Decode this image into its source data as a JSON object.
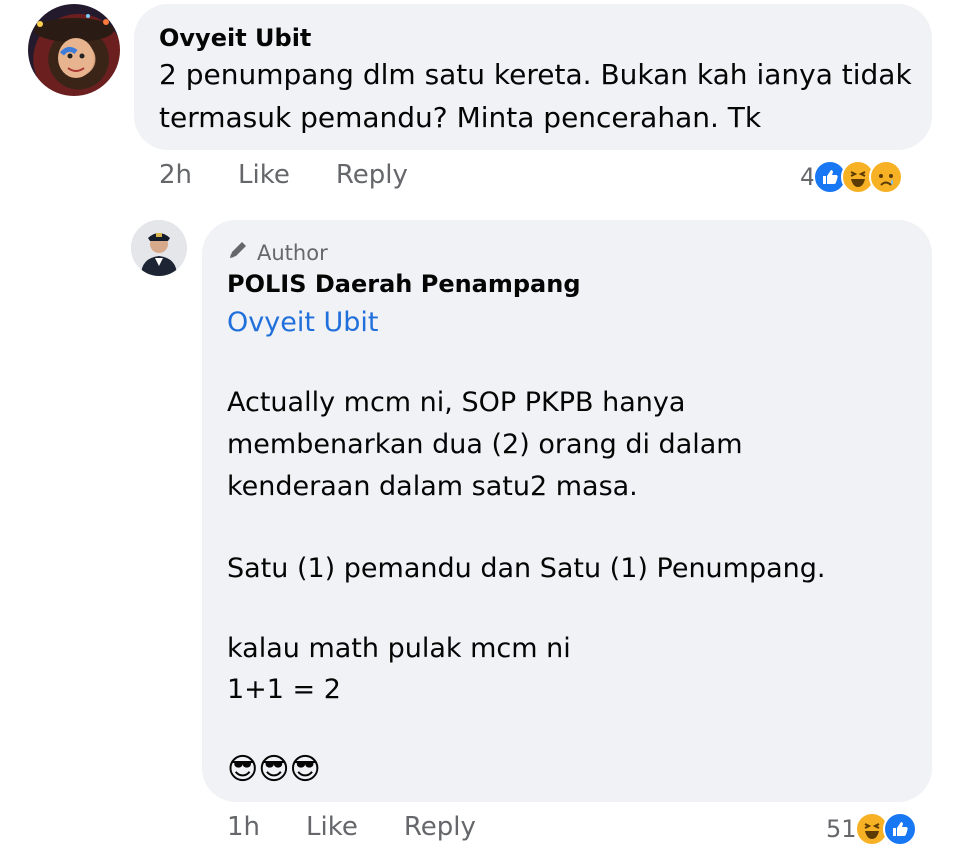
{
  "comment1": {
    "author": "Ovyeit Ubit",
    "lines": [
      "2 penumpang dlm satu kereta. Bukan kah ianya tidak",
      "termasuk pemandu? Minta pencerahan. Tk"
    ],
    "time": "2h",
    "like_label": "Like",
    "reply_label": "Reply",
    "reaction_count": "4",
    "reaction_icons": [
      "like-icon",
      "haha-icon",
      "sad-icon"
    ]
  },
  "comment2": {
    "badge": "Author",
    "author": "POLIS Daerah Penampang",
    "mention": "Ovyeit Ubit",
    "para1": [
      "Actually mcm ni, SOP PKPB hanya",
      "membenarkan dua (2) orang di dalam",
      "kenderaan dalam satu2 masa."
    ],
    "para2": "Satu (1) pemandu dan Satu (1) Penumpang.",
    "para3": [
      "kalau math pulak mcm ni",
      "1+1 = 2"
    ],
    "emojis": "😎😎😎",
    "time": "1h",
    "like_label": "Like",
    "reply_label": "Reply",
    "reaction_count": "51",
    "reaction_icons": [
      "haha-icon",
      "like-icon"
    ]
  },
  "colors": {
    "bubble": "#f0f2f5",
    "meta_text": "#65676b",
    "mention": "#216fdb",
    "like_blue": "#1877f2",
    "emoji_yellow": "#f7b125"
  }
}
